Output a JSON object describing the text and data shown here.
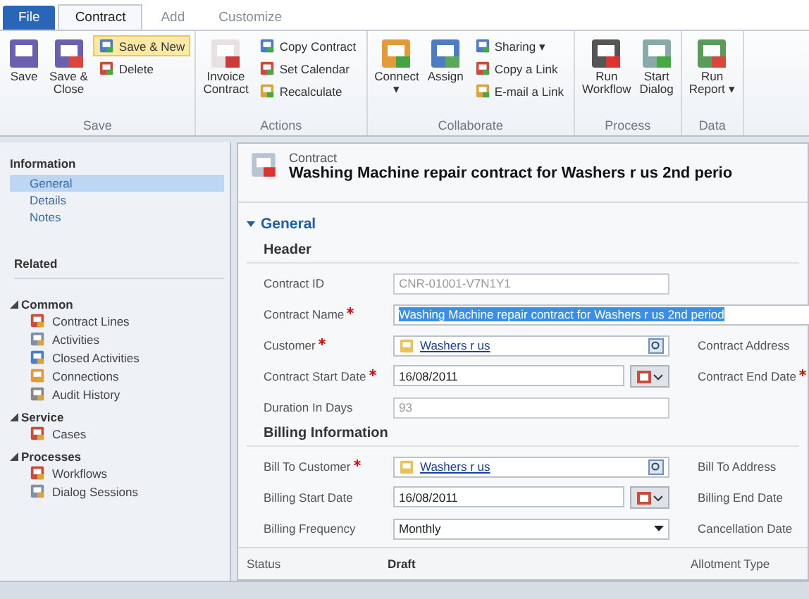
{
  "tabs": [
    {
      "label": "File",
      "kind": "file",
      "selected": false
    },
    {
      "label": "Contract",
      "kind": "tab",
      "selected": true
    },
    {
      "label": "Add",
      "kind": "tab",
      "selected": false
    },
    {
      "label": "Customize",
      "kind": "tab",
      "selected": false
    }
  ],
  "ribbon": [
    {
      "label": "Save",
      "items": [
        {
          "label": "Save",
          "kind": "large"
        },
        {
          "label": "Save &\nClose",
          "kind": "large"
        },
        {
          "kind": "stack",
          "stack": [
            {
              "label": "Save & New",
              "highlighted": true
            },
            {
              "label": "Delete",
              "highlighted": false
            }
          ]
        }
      ]
    },
    {
      "label": "Actions",
      "items": [
        {
          "label": "Invoice\nContract",
          "kind": "large"
        },
        {
          "kind": "stack",
          "stack": [
            {
              "label": "Copy Contract",
              "highlighted": false
            },
            {
              "label": "Set Calendar",
              "highlighted": false
            },
            {
              "label": "Recalculate",
              "highlighted": false
            }
          ]
        }
      ]
    },
    {
      "label": "Collaborate",
      "items": [
        {
          "label": "Connect\n▾",
          "kind": "large"
        },
        {
          "label": "Assign",
          "kind": "large"
        },
        {
          "kind": "stack",
          "stack": [
            {
              "label": "Sharing ▾",
              "highlighted": false
            },
            {
              "label": "Copy a Link",
              "highlighted": false
            },
            {
              "label": "E-mail a Link",
              "highlighted": false
            }
          ]
        }
      ]
    },
    {
      "label": "Process",
      "items": [
        {
          "label": "Run\nWorkflow",
          "kind": "large"
        },
        {
          "label": "Start\nDialog",
          "kind": "large"
        }
      ]
    },
    {
      "label": "Data",
      "items": [
        {
          "label": "Run\nReport ▾",
          "kind": "large"
        }
      ]
    }
  ],
  "sidebar": {
    "information": {
      "title": "Information",
      "items": [
        {
          "label": "General",
          "selected": true
        },
        {
          "label": "Details",
          "selected": false
        },
        {
          "label": "Notes",
          "selected": false
        }
      ]
    },
    "related": {
      "title": "Related",
      "groups": [
        {
          "title": "Common",
          "expanded": true,
          "items": [
            "Contract Lines",
            "Activities",
            "Closed Activities",
            "Connections",
            "Audit History"
          ]
        },
        {
          "title": "Service",
          "expanded": true,
          "items": [
            "Cases"
          ]
        },
        {
          "title": "Processes",
          "expanded": true,
          "items": [
            "Workflows",
            "Dialog Sessions"
          ]
        }
      ]
    }
  },
  "form": {
    "entity": "Contract",
    "title": "Washing Machine repair contract for Washers r us 2nd perio",
    "section": {
      "title": "General",
      "expanded": true
    },
    "groups": [
      {
        "title": "Header",
        "rows": [
          {
            "label": "Contract ID",
            "required": false,
            "kind": "readonly",
            "value": "CNR-01001-V7N1Y1"
          },
          {
            "label": "Contract Name",
            "required": true,
            "kind": "text",
            "value": "Washing Machine repair contract for Washers r us 2nd period",
            "highlighted": true
          },
          {
            "label": "Customer",
            "required": true,
            "kind": "lookup",
            "value": "Washers r us",
            "right_label": "Contract Address",
            "right_required": false
          },
          {
            "label": "Contract Start Date",
            "required": true,
            "kind": "date",
            "value": "16/08/2011",
            "right_label": "Contract End Date",
            "right_required": true
          },
          {
            "label": "Duration In Days",
            "required": false,
            "kind": "readonly",
            "value": "93"
          }
        ]
      },
      {
        "title": "Billing Information",
        "rows": [
          {
            "label": "Bill To Customer",
            "required": true,
            "kind": "lookup",
            "value": "Washers r us",
            "right_label": "Bill To Address",
            "right_required": false
          },
          {
            "label": "Billing Start Date",
            "required": false,
            "kind": "date",
            "value": "16/08/2011",
            "right_label": "Billing End Date",
            "right_required": false
          },
          {
            "label": "Billing Frequency",
            "required": false,
            "kind": "select",
            "value": "Monthly",
            "right_label": "Cancellation Date",
            "right_required": false
          }
        ]
      }
    ]
  },
  "footer": {
    "status_label": "Status",
    "status": "Draft",
    "right_label": "Allotment Type"
  }
}
